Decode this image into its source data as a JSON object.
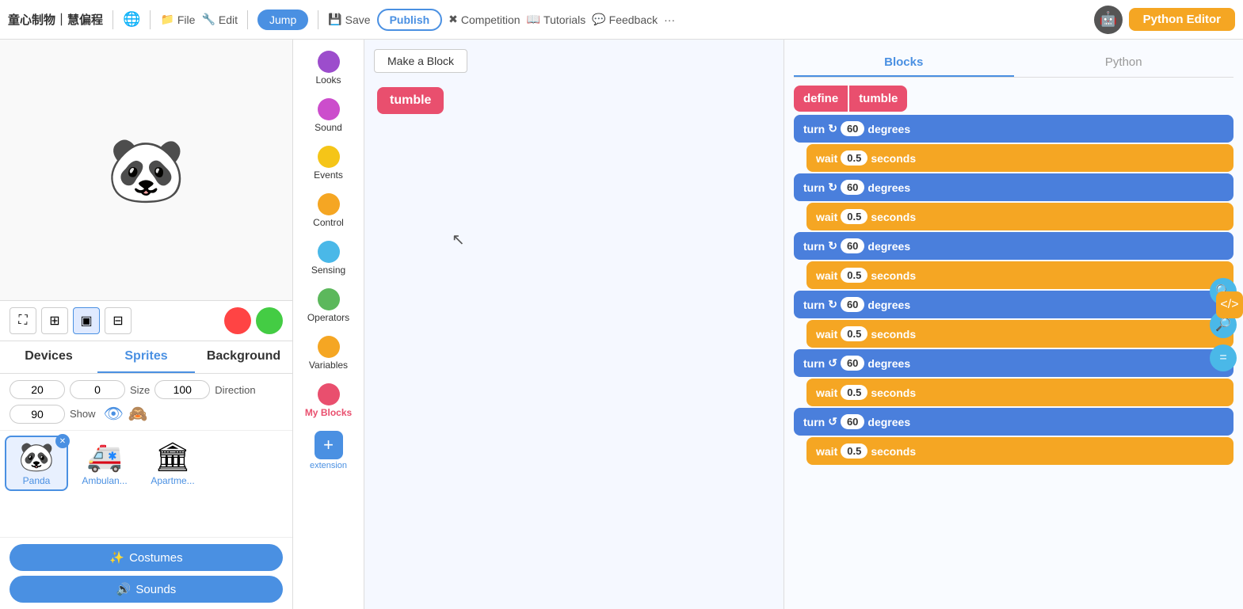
{
  "brand": "童心制物｜慧偏程",
  "nav": {
    "globe_icon": "🌐",
    "file_label": "File",
    "edit_label": "Edit",
    "jump_label": "Jump",
    "save_label": "Save",
    "publish_label": "Publish",
    "competition_label": "Competition",
    "tutorials_label": "Tutorials",
    "feedback_label": "Feedback",
    "more_label": "···",
    "python_editor_label": "Python Editor"
  },
  "stage_controls": [
    {
      "icon": "⛶",
      "selected": false
    },
    {
      "icon": "⊞",
      "selected": false
    },
    {
      "icon": "▣",
      "selected": true
    },
    {
      "icon": "⊟",
      "selected": false
    }
  ],
  "sprite_tabs": [
    {
      "label": "Devices",
      "active": false
    },
    {
      "label": "Sprites",
      "active": true
    },
    {
      "label": "Background",
      "active": false
    }
  ],
  "sprite_props": {
    "x_label": "20",
    "y_label": "0",
    "size_label": "Size",
    "size_val": "100",
    "direction_label": "Direction",
    "direction_val": "90",
    "show_label": "Show"
  },
  "sprites": [
    {
      "name": "Panda",
      "emoji": "🐼",
      "selected": true,
      "has_close": true
    },
    {
      "name": "Ambulan...",
      "emoji": "🚑",
      "selected": false,
      "has_close": false
    },
    {
      "name": "Apartme...",
      "emoji": "🏛",
      "selected": false,
      "has_close": false
    }
  ],
  "bottom_btns": [
    {
      "label": "Costumes",
      "icon": "✨"
    },
    {
      "label": "Sounds",
      "icon": "🔊"
    }
  ],
  "categories": [
    {
      "dot_color": "#9c4dcc",
      "label": "Looks"
    },
    {
      "dot_color": "#cc4dcc",
      "label": "Sound"
    },
    {
      "dot_color": "#f5c518",
      "label": "Events"
    },
    {
      "dot_color": "#f5a623",
      "label": "Control"
    },
    {
      "dot_color": "#4ab8e8",
      "label": "Sensing"
    },
    {
      "dot_color": "#5cb85c",
      "label": "Operators"
    },
    {
      "dot_color": "#f5a623",
      "label": "Variables"
    },
    {
      "dot_color": "#e94f6e",
      "label": "My Blocks",
      "myblocks": true
    }
  ],
  "workspace": {
    "make_block_label": "Make a Block",
    "tumble_label": "tumble"
  },
  "blocks_python_tabs": [
    {
      "label": "Blocks",
      "active": true
    },
    {
      "label": "Python",
      "active": false
    }
  ],
  "define_block": {
    "define_label": "define",
    "name_label": "tumble"
  },
  "block_sequence": [
    {
      "type": "turn",
      "dir": "↻",
      "val": "60",
      "unit": "degrees"
    },
    {
      "type": "wait",
      "val": "0.5",
      "unit": "seconds"
    },
    {
      "type": "turn",
      "dir": "↻",
      "val": "60",
      "unit": "degrees"
    },
    {
      "type": "wait",
      "val": "0.5",
      "unit": "seconds"
    },
    {
      "type": "turn",
      "dir": "↻",
      "val": "60",
      "unit": "degrees"
    },
    {
      "type": "wait",
      "val": "0.5",
      "unit": "seconds"
    },
    {
      "type": "turn",
      "dir": "↻",
      "val": "60",
      "unit": "degrees"
    },
    {
      "type": "wait",
      "val": "0.5",
      "unit": "seconds"
    },
    {
      "type": "turn",
      "dir": "↺",
      "val": "60",
      "unit": "degrees"
    },
    {
      "type": "wait",
      "val": "0.5",
      "unit": "seconds"
    },
    {
      "type": "turn",
      "dir": "↺",
      "val": "60",
      "unit": "degrees"
    },
    {
      "type": "wait",
      "val": "0.5",
      "unit": "seconds"
    }
  ],
  "right_tools": [
    {
      "icon": "</>",
      "type": "code"
    },
    {
      "icon": "🔍",
      "type": "search"
    },
    {
      "icon": "🔎",
      "type": "zoom-out"
    },
    {
      "icon": "=",
      "type": "eq"
    }
  ]
}
